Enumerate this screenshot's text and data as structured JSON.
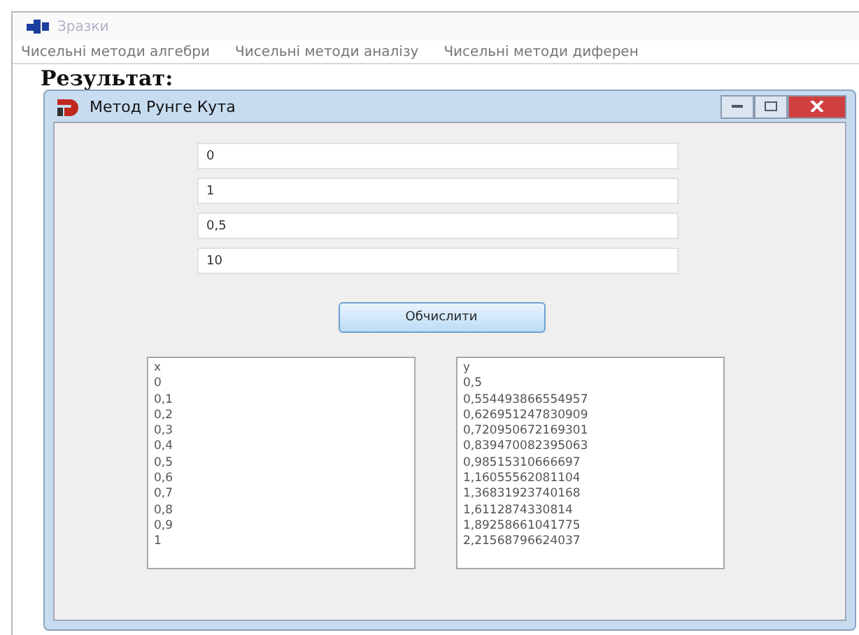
{
  "window": {
    "title": "Зразки"
  },
  "menu": [
    "Чисельні методи алгебри",
    "Чисельні методи аналізу",
    "Чисельні методи диферен"
  ],
  "heading": "Результат:",
  "dialog": {
    "title": "Метод Рунге Кута",
    "fields": [
      {
        "value": "0"
      },
      {
        "value": "1"
      },
      {
        "value": "0,5"
      },
      {
        "value": "10"
      }
    ],
    "button": "Обчислити",
    "lists": [
      {
        "items": [
          "x",
          "0",
          "0,1",
          "0,2",
          "0,3",
          "0,4",
          "0,5",
          "0,6",
          "0,7",
          "0,8",
          "0,9",
          "1"
        ]
      },
      {
        "items": [
          "y",
          "0,5",
          "0,554493866554957",
          "0,626951247830909",
          "0,720950672169301",
          "0,839470082395063",
          "0,98515310666697",
          "1,16055562081104",
          "1,36831923740168",
          "1,6112874330814",
          "1,89258661041775",
          "2,21568796624037"
        ]
      }
    ]
  }
}
